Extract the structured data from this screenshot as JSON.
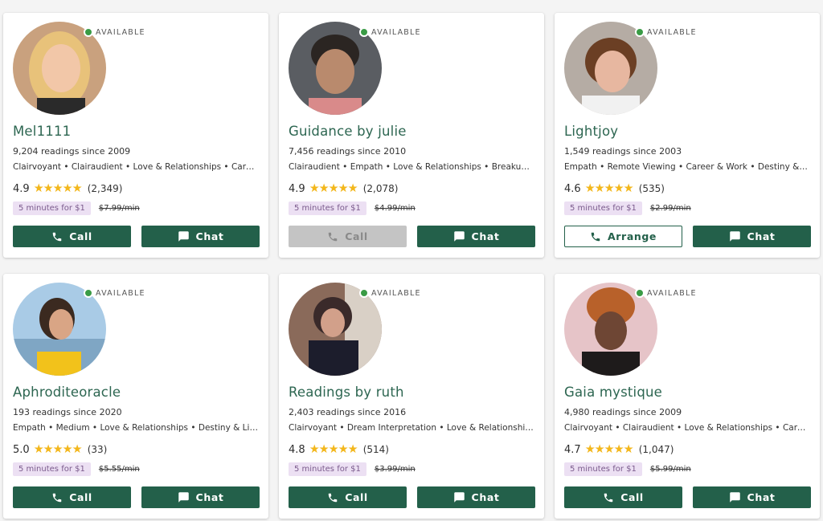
{
  "status_label": "AVAILABLE",
  "colors": {
    "accent": "#23604a",
    "name": "#2d6651",
    "available": "#3a9b45",
    "star": "#f3b71c",
    "promo_bg": "#ece0f3",
    "disabled": "#c4c4c4"
  },
  "cards": [
    {
      "name": "Mel1111",
      "readings": "9,204 readings since 2009",
      "specialties": "Clairvoyant • Clairaudient • Love & Relationships • Career & Work",
      "rating": "4.9",
      "stars": "★★★★★",
      "count": "(2,349)",
      "promo": "5 minutes for $1",
      "price": "$7.99/min",
      "btn1": {
        "label": "Call",
        "icon": "phone-icon",
        "style": "solid"
      },
      "btn2": {
        "label": "Chat",
        "icon": "chat-icon",
        "style": "solid"
      }
    },
    {
      "name": "Guidance by julie",
      "readings": "7,456 readings since 2010",
      "specialties": "Clairaudient • Empath • Love & Relationships • Breakups/Divorce",
      "rating": "4.9",
      "stars": "★★★★★",
      "count": "(2,078)",
      "promo": "5 minutes for $1",
      "price": "$4.99/min",
      "btn1": {
        "label": "Call",
        "icon": "phone-icon",
        "style": "disabled"
      },
      "btn2": {
        "label": "Chat",
        "icon": "chat-icon",
        "style": "solid"
      }
    },
    {
      "name": "Lightjoy",
      "readings": "1,549 readings since 2003",
      "specialties": "Empath • Remote Viewing • Career & Work • Destiny & Life Path",
      "rating": "4.6",
      "stars": "★★★★★",
      "count": "(535)",
      "promo": "5 minutes for $1",
      "price": "$2.99/min",
      "btn1": {
        "label": "Arrange",
        "icon": "phone-icon",
        "style": "outline"
      },
      "btn2": {
        "label": "Chat",
        "icon": "chat-icon",
        "style": "solid"
      }
    },
    {
      "name": "Aphroditeoracle",
      "readings": "193 readings since 2020",
      "specialties": "Empath • Medium • Love & Relationships • Destiny & Life Path",
      "rating": "5.0",
      "stars": "★★★★★",
      "count": "(33)",
      "promo": "5 minutes for $1",
      "price": "$5.55/min",
      "btn1": {
        "label": "Call",
        "icon": "phone-icon",
        "style": "solid"
      },
      "btn2": {
        "label": "Chat",
        "icon": "chat-icon",
        "style": "solid"
      }
    },
    {
      "name": "Readings by ruth",
      "readings": "2,403 readings since 2016",
      "specialties": "Clairvoyant • Dream Interpretation • Love & Relationships • Career",
      "rating": "4.8",
      "stars": "★★★★★",
      "count": "(514)",
      "promo": "5 minutes for $1",
      "price": "$3.99/min",
      "btn1": {
        "label": "Call",
        "icon": "phone-icon",
        "style": "solid"
      },
      "btn2": {
        "label": "Chat",
        "icon": "chat-icon",
        "style": "solid"
      }
    },
    {
      "name": "Gaia mystique",
      "readings": "4,980 readings since 2009",
      "specialties": "Clairvoyant • Clairaudient • Love & Relationships • Career & Work",
      "rating": "4.7",
      "stars": "★★★★★",
      "count": "(1,047)",
      "promo": "5 minutes for $1",
      "price": "$5.99/min",
      "btn1": {
        "label": "Call",
        "icon": "phone-icon",
        "style": "solid"
      },
      "btn2": {
        "label": "Chat",
        "icon": "chat-icon",
        "style": "solid"
      }
    }
  ]
}
